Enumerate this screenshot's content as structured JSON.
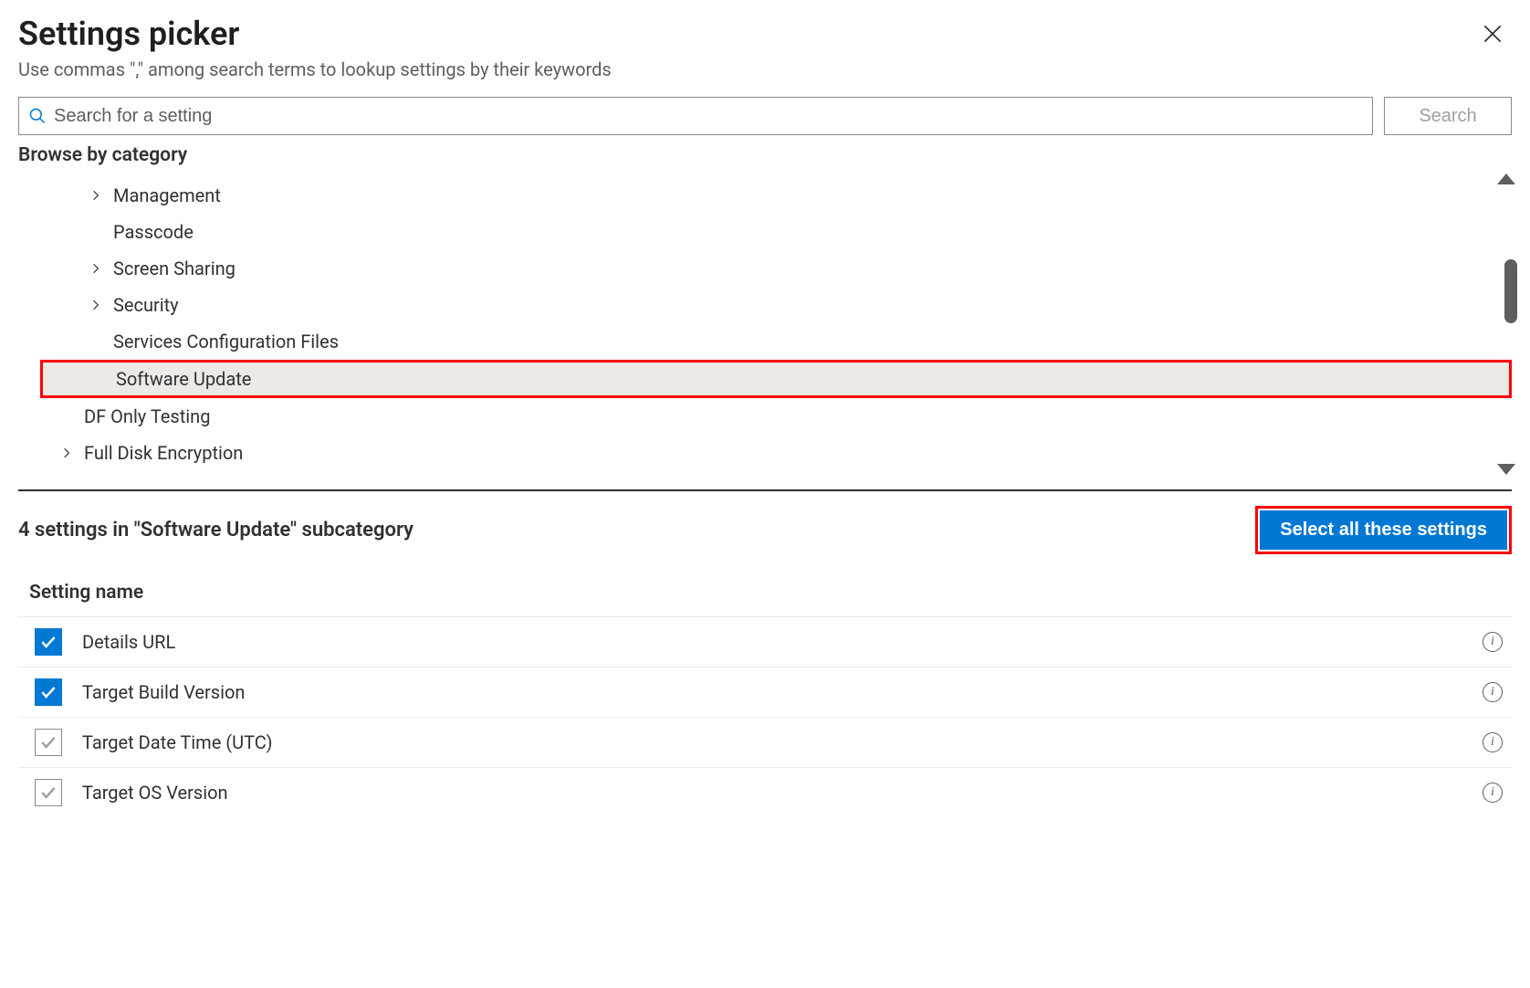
{
  "header": {
    "title": "Settings picker",
    "subtitle": "Use commas \",\" among search terms to lookup settings by their keywords"
  },
  "search": {
    "placeholder": "Search for a setting",
    "button_label": "Search"
  },
  "browse_label": "Browse by category",
  "categories": [
    {
      "label": "Management",
      "expandable": true,
      "indent": 1,
      "selected": false
    },
    {
      "label": "Passcode",
      "expandable": false,
      "indent": 1,
      "selected": false
    },
    {
      "label": "Screen Sharing",
      "expandable": true,
      "indent": 1,
      "selected": false
    },
    {
      "label": "Security",
      "expandable": true,
      "indent": 1,
      "selected": false
    },
    {
      "label": "Services Configuration Files",
      "expandable": false,
      "indent": 1,
      "selected": false
    },
    {
      "label": "Software Update",
      "expandable": false,
      "indent": 1,
      "selected": true
    },
    {
      "label": "DF Only Testing",
      "expandable": false,
      "indent": 0,
      "selected": false
    },
    {
      "label": "Full Disk Encryption",
      "expandable": true,
      "indent": 0,
      "selected": false
    }
  ],
  "sub_header": "4 settings in \"Software Update\" subcategory",
  "select_all_label": "Select all these settings",
  "column_header": "Setting name",
  "settings": [
    {
      "name": "Details URL",
      "checked": true
    },
    {
      "name": "Target Build Version",
      "checked": true
    },
    {
      "name": "Target Date Time (UTC)",
      "checked": false
    },
    {
      "name": "Target OS Version",
      "checked": false
    }
  ]
}
